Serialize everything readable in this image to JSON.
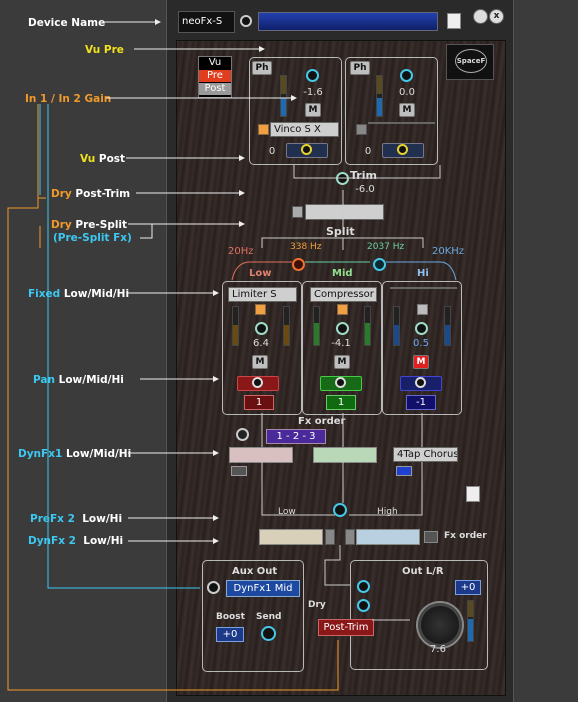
{
  "labels": {
    "device_name": "Device Name",
    "vu_pre": "Vu Pre",
    "in_gain": "In 1 / In 2 Gain",
    "vu_post_a": "Vu",
    "vu_post_b": "Post",
    "dry_post_trim_a": "Dry",
    "dry_post_trim_b": "Post-Trim",
    "dry_pre_split_a": "Dry",
    "dry_pre_split_b": "Pre-Split",
    "pre_split_fx": "(Pre-Split Fx)",
    "fixed": "Fixed",
    "fixed_b": "Low/Mid/Hi",
    "pan": "Pan",
    "pan_b": "Low/Mid/Hi",
    "dynfx1": "DynFx1",
    "dynfx1_b": "Low/Mid/Hi",
    "prefx2": "PreFx 2",
    "prefx2_b": "Low/Hi",
    "dynfx2": "DynFx 2",
    "dynfx2_b": "Low/Hi"
  },
  "device": {
    "name": "neoFx-S",
    "logo": "SpaceF"
  },
  "vu_selector": [
    "Vu",
    "Pre",
    "Post"
  ],
  "in1": {
    "ph": "Ph",
    "gain": "-1.6",
    "m": "M",
    "fx": "Vinco S X",
    "val": "0"
  },
  "in2": {
    "ph": "Ph",
    "gain": "0.0",
    "m": "M",
    "fx": "",
    "val": "0"
  },
  "trim": {
    "label": "Trim",
    "value": "-6.0"
  },
  "split": {
    "label": "Split",
    "f_low": "20Hz",
    "f1": "338 Hz",
    "f2": "2037 Hz",
    "f_high": "20KHz"
  },
  "bands": [
    {
      "name": "Low",
      "fx": "Limiter S",
      "val": "6.4",
      "m": "M",
      "pan": "1"
    },
    {
      "name": "Mid",
      "fx": "Compressor",
      "val": "-4.1",
      "m": "M",
      "pan": "1"
    },
    {
      "name": "Hi",
      "fx": "",
      "val": "0.5",
      "m": "M",
      "pan": "-1"
    }
  ],
  "fx_order": {
    "label": "Fx order",
    "value": "1 - 2 - 3",
    "label2": "Fx order"
  },
  "dynfx1_slots": [
    "",
    "",
    "4Tap Chorus"
  ],
  "prefx2": {
    "low": "Low",
    "high": "High"
  },
  "aux": {
    "title": "Aux Out",
    "source": "DynFx1 Mid",
    "boost": "Boost",
    "send": "Send",
    "boost_val": "+0"
  },
  "out": {
    "title": "Out L/R",
    "dry": "Dry",
    "post_trim": "Post-Trim",
    "level": "+0",
    "value": "7.6"
  }
}
